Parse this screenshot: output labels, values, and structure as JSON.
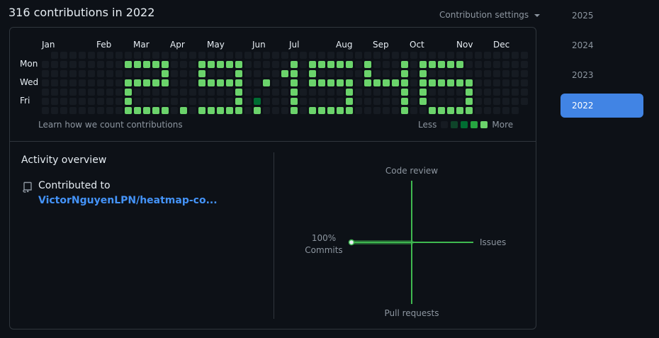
{
  "header": {
    "title": "316 contributions in 2022",
    "settings_label": "Contribution settings"
  },
  "calendar": {
    "months": [
      "Jan",
      "Feb",
      "Mar",
      "Apr",
      "May",
      "Jun",
      "Jul",
      "Aug",
      "Sep",
      "Oct",
      "Nov",
      "Dec"
    ],
    "day_labels": [
      "Mon",
      "Wed",
      "Fri"
    ],
    "learn_link": "Learn how we count contributions",
    "legend_less": "Less",
    "legend_more": "More",
    "colors": {
      "empty": "#161b22",
      "l1": "#0e4429",
      "l2": "#006d32",
      "l3": "#26a641",
      "l4": "#6bd36b",
      "legend": [
        "#161b22",
        "#0e4429",
        "#006d32",
        "#26a641",
        "#6bd36b"
      ]
    },
    "cells_by_week": [
      "-------",
      "0000000",
      "0000000",
      "0000000",
      "0000000",
      "0000000",
      "0000000",
      "0000000",
      "0000000",
      "0400000",
      "0400000",
      "0400000",
      "0400000",
      "0444444",
      "0000000",
      "0000000",
      "0000000",
      "0444444",
      "0444444",
      "0444444",
      "0444444",
      "0444444",
      "0000000",
      "0000000",
      "0000000",
      "0444444",
      "0000000",
      "0000000",
      "0000000",
      "0444444",
      "0444444",
      "0444444",
      "0444444",
      "0444444",
      "0000000",
      "0000000",
      "0000000",
      "0444444",
      "0444444",
      "0444444",
      "0444444",
      "0444444",
      "0000000",
      "0000000",
      "0000000",
      "0444444",
      "0000000",
      "0000000"
    ],
    "active_cells": [
      [
        9,
        1
      ],
      [
        10,
        1
      ],
      [
        11,
        1
      ],
      [
        12,
        1
      ],
      [
        13,
        1
      ],
      [
        13,
        2
      ],
      [
        9,
        3
      ],
      [
        10,
        3
      ],
      [
        11,
        3
      ],
      [
        12,
        3
      ],
      [
        13,
        3
      ],
      [
        9,
        4
      ],
      [
        9,
        5
      ],
      [
        9,
        6
      ],
      [
        10,
        6
      ],
      [
        11,
        6
      ],
      [
        12,
        6
      ],
      [
        13,
        6
      ],
      [
        15,
        6
      ],
      [
        17,
        1
      ],
      [
        18,
        1
      ],
      [
        19,
        1
      ],
      [
        20,
        1
      ],
      [
        21,
        1
      ],
      [
        17,
        2
      ],
      [
        21,
        2
      ],
      [
        17,
        3
      ],
      [
        18,
        3
      ],
      [
        19,
        3
      ],
      [
        20,
        3
      ],
      [
        21,
        3
      ],
      [
        21,
        4
      ],
      [
        21,
        5
      ],
      [
        17,
        6
      ],
      [
        18,
        6
      ],
      [
        19,
        6
      ],
      [
        20,
        6
      ],
      [
        21,
        6
      ],
      [
        24,
        3
      ],
      [
        23,
        5
      ],
      [
        23,
        6
      ],
      [
        27,
        1
      ],
      [
        26,
        2
      ],
      [
        27,
        2
      ],
      [
        27,
        3
      ],
      [
        27,
        4
      ],
      [
        27,
        5
      ],
      [
        27,
        6
      ],
      [
        29,
        1
      ],
      [
        30,
        1
      ],
      [
        31,
        1
      ],
      [
        32,
        1
      ],
      [
        33,
        1
      ],
      [
        29,
        2
      ],
      [
        29,
        3
      ],
      [
        30,
        3
      ],
      [
        31,
        3
      ],
      [
        32,
        3
      ],
      [
        33,
        3
      ],
      [
        33,
        4
      ],
      [
        33,
        5
      ],
      [
        29,
        6
      ],
      [
        30,
        6
      ],
      [
        31,
        6
      ],
      [
        32,
        6
      ],
      [
        33,
        6
      ],
      [
        35,
        1
      ],
      [
        35,
        2
      ],
      [
        35,
        3
      ],
      [
        36,
        3
      ],
      [
        37,
        3
      ],
      [
        38,
        3
      ],
      [
        39,
        3
      ],
      [
        39,
        1
      ],
      [
        39,
        2
      ],
      [
        39,
        4
      ],
      [
        39,
        5
      ],
      [
        39,
        6
      ],
      [
        41,
        1
      ],
      [
        41,
        2
      ],
      [
        41,
        3
      ],
      [
        41,
        4
      ],
      [
        41,
        5
      ],
      [
        42,
        6
      ],
      [
        43,
        6
      ],
      [
        44,
        6
      ],
      [
        45,
        6
      ],
      [
        46,
        6
      ],
      [
        42,
        1
      ],
      [
        43,
        1
      ],
      [
        44,
        1
      ],
      [
        45,
        1
      ],
      [
        46,
        3
      ],
      [
        45,
        3
      ],
      [
        44,
        3
      ],
      [
        43,
        3
      ],
      [
        42,
        3
      ],
      [
        46,
        4
      ],
      [
        46,
        5
      ]
    ],
    "dim_cells": [
      [
        23,
        5
      ]
    ]
  },
  "overview": {
    "title": "Activity overview",
    "contributed_to": "Contributed to",
    "repo_link": "VictorNguyenLPN/heatmap-co...",
    "axes": {
      "top": "Code review",
      "right": "Issues",
      "bottom": "Pull requests",
      "left_pct": "100%",
      "left": "Commits"
    },
    "commits_share": 100,
    "accent": "#3fb950"
  },
  "years": {
    "items": [
      "2025",
      "2024",
      "2023",
      "2022"
    ],
    "active": "2022"
  }
}
